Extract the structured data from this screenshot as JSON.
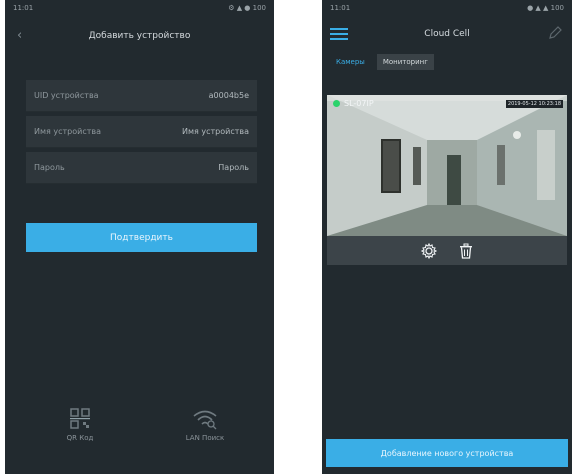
{
  "left": {
    "status_time": "11:01",
    "status_icons": "⚙ ▲ ● 100",
    "title": "Добавить устройство",
    "fields": [
      {
        "label": "UID устройства",
        "value": "a0004b5e"
      },
      {
        "label": "Имя устройства",
        "value": "Имя устройства"
      },
      {
        "label": "Пароль",
        "value": "Пароль"
      }
    ],
    "confirm_label": "Подтвердить",
    "bottom": [
      {
        "label": "QR Код",
        "icon": "qr-code-icon"
      },
      {
        "label": "LAN Поиск",
        "icon": "wifi-search-icon"
      }
    ]
  },
  "right": {
    "status_time": "11:01",
    "status_icons": "● ▲ ▲ 100",
    "title": "Cloud Cell",
    "tabs": [
      {
        "label": "Камеры",
        "active": true
      },
      {
        "label": "Мониторинг",
        "active": false
      }
    ],
    "camera": {
      "name": "SL-07IP",
      "timestamp": "2019-05-12 10:23:18",
      "online_color": "#2bd36b"
    },
    "add_label": "Добавление нового устройства"
  },
  "colors": {
    "accent": "#3aaee6",
    "background": "#222a2f"
  }
}
